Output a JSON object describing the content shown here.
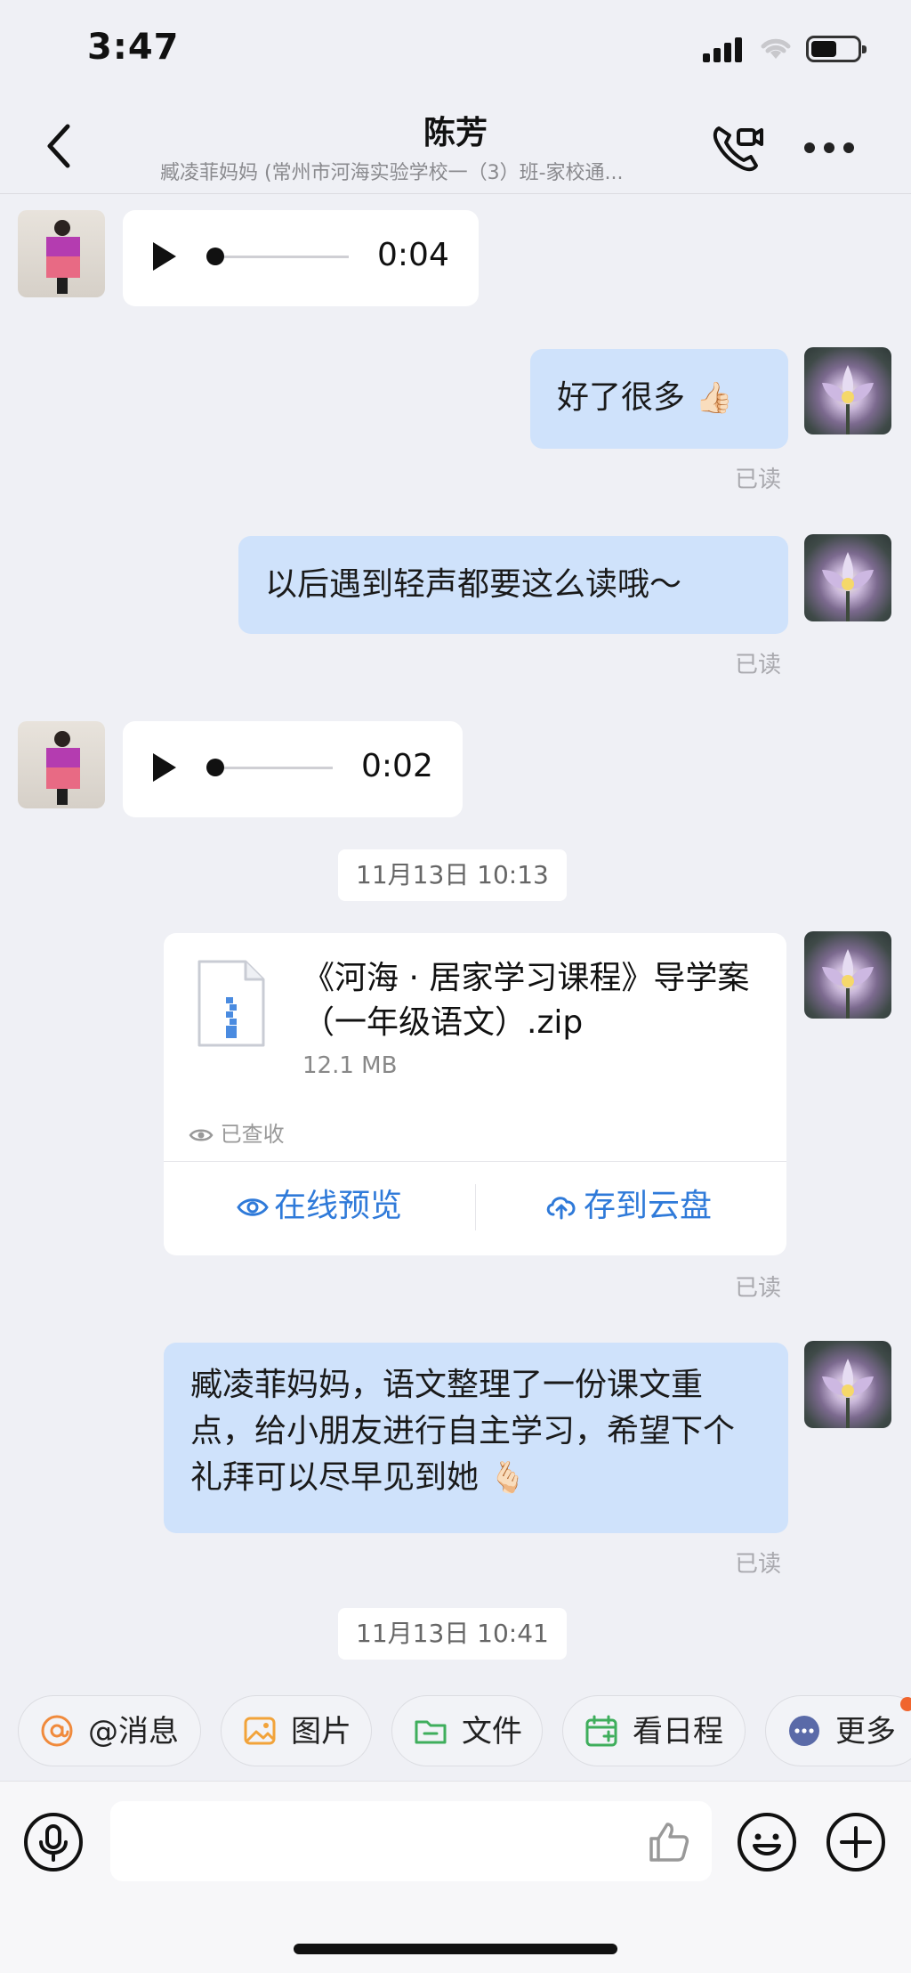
{
  "status_bar": {
    "time": "3:47"
  },
  "header": {
    "title": "陈芳",
    "subtitle": "臧凌菲妈妈 (常州市河海实验学校一（3）班-家校通..."
  },
  "messages": {
    "voice1": {
      "duration": "0:04"
    },
    "text1": {
      "text": "好了很多",
      "emoji": "👍🏻",
      "read": "已读"
    },
    "text2": {
      "text": "以后遇到轻声都要这么读哦～",
      "read": "已读"
    },
    "voice2": {
      "duration": "0:02"
    },
    "timestamp1": "11月13日 10:13",
    "file": {
      "name": "《河海 · 居家学习课程》导学案（一年级语文）.zip",
      "size": "12.1 MB",
      "status": "已查收",
      "preview_label": "在线预览",
      "save_label": "存到云盘",
      "read": "已读"
    },
    "text3": {
      "text": "臧凌菲妈妈，语文整理了一份课文重点，给小朋友进行自主学习，希望下个礼拜可以尽早见到她",
      "emoji": "🫰🏻",
      "read": "已读"
    },
    "timestamp2": "11月13日 10:41"
  },
  "quick_actions": [
    {
      "label": "@消息",
      "icon": "at-icon",
      "color": "#f08a3c"
    },
    {
      "label": "图片",
      "icon": "image-icon",
      "color": "#f2a33a"
    },
    {
      "label": "文件",
      "icon": "folder-icon",
      "color": "#3fae5c"
    },
    {
      "label": "看日程",
      "icon": "calendar-icon",
      "color": "#3fae5c"
    },
    {
      "label": "更多",
      "icon": "more-circle-icon",
      "color": "#5a6aa8"
    }
  ],
  "colors": {
    "background": "#eff0f5",
    "bubble_outgoing": "#cfe2fb",
    "bubble_incoming": "#ffffff",
    "action_blue": "#2f7ad9",
    "notification_dot": "#f0652e"
  }
}
